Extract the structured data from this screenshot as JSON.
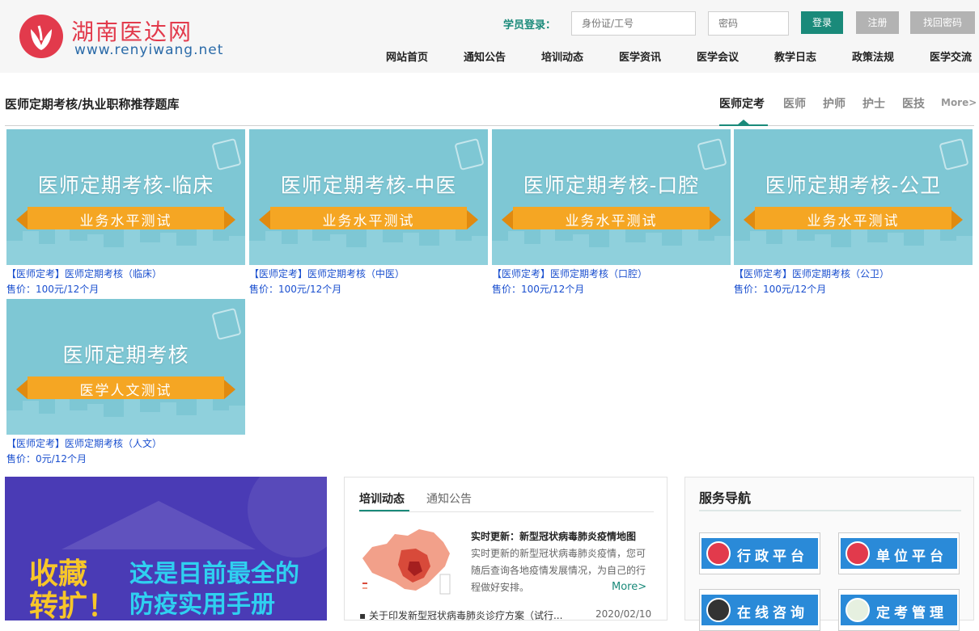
{
  "header": {
    "logo_cn": "湖南医达网",
    "logo_en": "www.renyiwang.net",
    "login_label": "学员登录：",
    "id_placeholder": "身份证/工号",
    "pw_placeholder": "密码",
    "login_btn": "登录",
    "register_btn": "注册",
    "find_pw_btn": "找回密码",
    "nav": [
      "网站首页",
      "通知公告",
      "培训动态",
      "医学资讯",
      "医学会议",
      "教学日志",
      "政策法规",
      "医学交流"
    ]
  },
  "section": {
    "title": "医师定期考核/执业职称推荐题库",
    "categories": [
      "医师定考",
      "医师",
      "护师",
      "护士",
      "医技"
    ],
    "active_category": "医师定考",
    "more": "More>"
  },
  "courses": [
    {
      "banner_title": "医师定期考核-临床",
      "ribbon": "业务水平测试",
      "title": "【医师定考】医师定期考核（临床）",
      "price": "售价：100元/12个月"
    },
    {
      "banner_title": "医师定期考核-中医",
      "ribbon": "业务水平测试",
      "title": "【医师定考】医师定期考核（中医）",
      "price": "售价：100元/12个月"
    },
    {
      "banner_title": "医师定期考核-口腔",
      "ribbon": "业务水平测试",
      "title": "【医师定考】医师定期考核（口腔）",
      "price": "售价：100元/12个月"
    },
    {
      "banner_title": "医师定期考核-公卫",
      "ribbon": "业务水平测试",
      "title": "【医师定考】医师定期考核（公卫）",
      "price": "售价：100元/12个月"
    },
    {
      "banner_title": "医师定期考核",
      "ribbon": "医学人文测试",
      "title": "【医师定考】医师定期考核（人文）",
      "price": "售价：0元/12个月"
    }
  ],
  "promo": {
    "left_line1": "收藏",
    "left_line2": "转扩！",
    "right_line1": "这是目前最全的",
    "right_line2": "防疫实用手册"
  },
  "news": {
    "tabs": [
      "培训动态",
      "通知公告"
    ],
    "active_tab": "培训动态",
    "headline": "实时更新：新型冠状病毒肺炎疫情地图",
    "desc": "实时更新的新型冠状病毒肺炎疫情，您可随后查询各地疫情发展情况，为自己的行程做好安排。",
    "more": "More>",
    "items": [
      {
        "title": "▪ 关于印发新型冠状病毒肺炎诊疗方案（试行...",
        "date": "2020/02/10"
      }
    ]
  },
  "service": {
    "title": "服务导航",
    "buttons": [
      "行政平台",
      "单位平台",
      "在线咨询",
      "定考管理"
    ]
  },
  "colors": {
    "brand_red": "#e23a4c",
    "teal": "#1a8a7a",
    "banner_blue": "#7ec7d4",
    "ribbon_orange": "#f5a623",
    "link_blue": "#1a4fcf"
  }
}
